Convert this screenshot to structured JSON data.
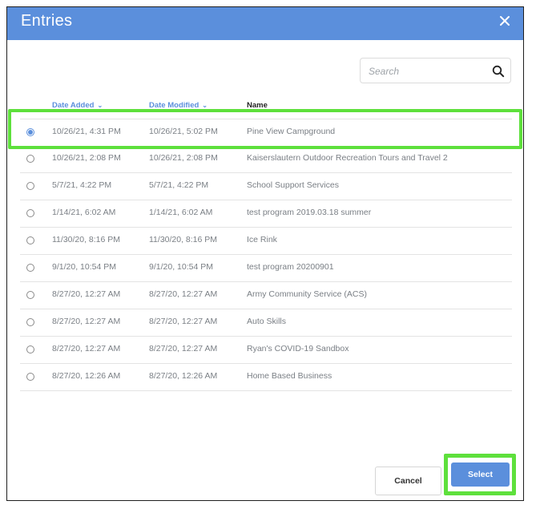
{
  "dialog": {
    "title": "Entries",
    "search_placeholder": "Search",
    "columns": {
      "date_added": "Date Added",
      "date_modified": "Date Modified",
      "name": "Name"
    },
    "rows": [
      {
        "date_added": "10/26/21, 4:31 PM",
        "date_modified": "10/26/21, 5:02 PM",
        "name": "Pine View Campground",
        "selected": true
      },
      {
        "date_added": "10/26/21, 2:08 PM",
        "date_modified": "10/26/21, 2:08 PM",
        "name": "Kaiserslautern Outdoor Recreation Tours and Travel 2",
        "selected": false
      },
      {
        "date_added": "5/7/21, 4:22 PM",
        "date_modified": "5/7/21, 4:22 PM",
        "name": "School Support Services",
        "selected": false
      },
      {
        "date_added": "1/14/21, 6:02 AM",
        "date_modified": "1/14/21, 6:02 AM",
        "name": "test program 2019.03.18 summer",
        "selected": false
      },
      {
        "date_added": "11/30/20, 8:16 PM",
        "date_modified": "11/30/20, 8:16 PM",
        "name": "Ice Rink",
        "selected": false
      },
      {
        "date_added": "9/1/20, 10:54 PM",
        "date_modified": "9/1/20, 10:54 PM",
        "name": "test program 20200901",
        "selected": false
      },
      {
        "date_added": "8/27/20, 12:27 AM",
        "date_modified": "8/27/20, 12:27 AM",
        "name": "Army Community Service (ACS)",
        "selected": false
      },
      {
        "date_added": "8/27/20, 12:27 AM",
        "date_modified": "8/27/20, 12:27 AM",
        "name": "Auto Skills",
        "selected": false
      },
      {
        "date_added": "8/27/20, 12:27 AM",
        "date_modified": "8/27/20, 12:27 AM",
        "name": "Ryan's COVID-19 Sandbox",
        "selected": false
      },
      {
        "date_added": "8/27/20, 12:26 AM",
        "date_modified": "8/27/20, 12:26 AM",
        "name": "Home Based Business",
        "selected": false
      }
    ],
    "buttons": {
      "cancel": "Cancel",
      "select": "Select"
    }
  },
  "colors": {
    "header": "#5b8fdc",
    "accent": "#5b8fdc",
    "highlight": "#5ee03c",
    "text_muted": "#7a7f85"
  },
  "icons": {
    "close": "close-icon",
    "search": "search-icon",
    "sort": "chevron-down-icon"
  }
}
